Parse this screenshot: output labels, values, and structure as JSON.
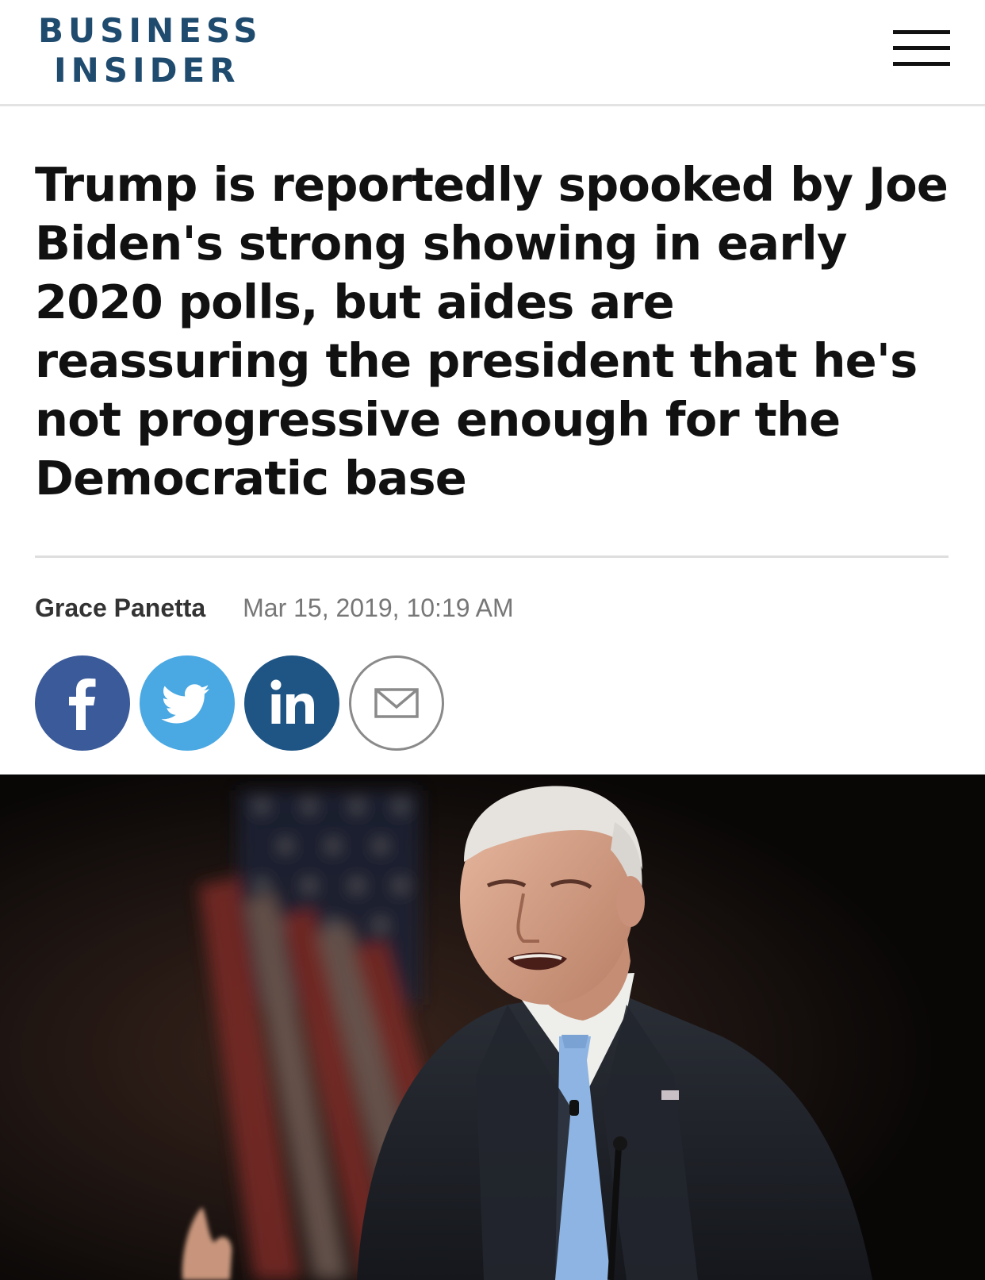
{
  "header": {
    "logo_line1": "BUSINESS",
    "logo_line2": "INSIDER",
    "logo_color": "#1f4b6e"
  },
  "article": {
    "headline": "Trump is reportedly spooked by Joe Biden's strong showing in early 2020 polls, but aides are reassuring the president that he's not progressive enough for the Democratic base",
    "author": "Grace Panetta",
    "date": "Mar 15, 2019, 10:19 AM"
  },
  "share": [
    {
      "icon": "facebook-icon",
      "color": "#3b5a9a"
    },
    {
      "icon": "twitter-icon",
      "color": "#4aa8e3"
    },
    {
      "icon": "linkedin-icon",
      "color": "#1f5584"
    },
    {
      "icon": "email-icon",
      "color": "#8a8a8a"
    }
  ],
  "icons": {
    "menu": "hamburger-menu-icon"
  }
}
